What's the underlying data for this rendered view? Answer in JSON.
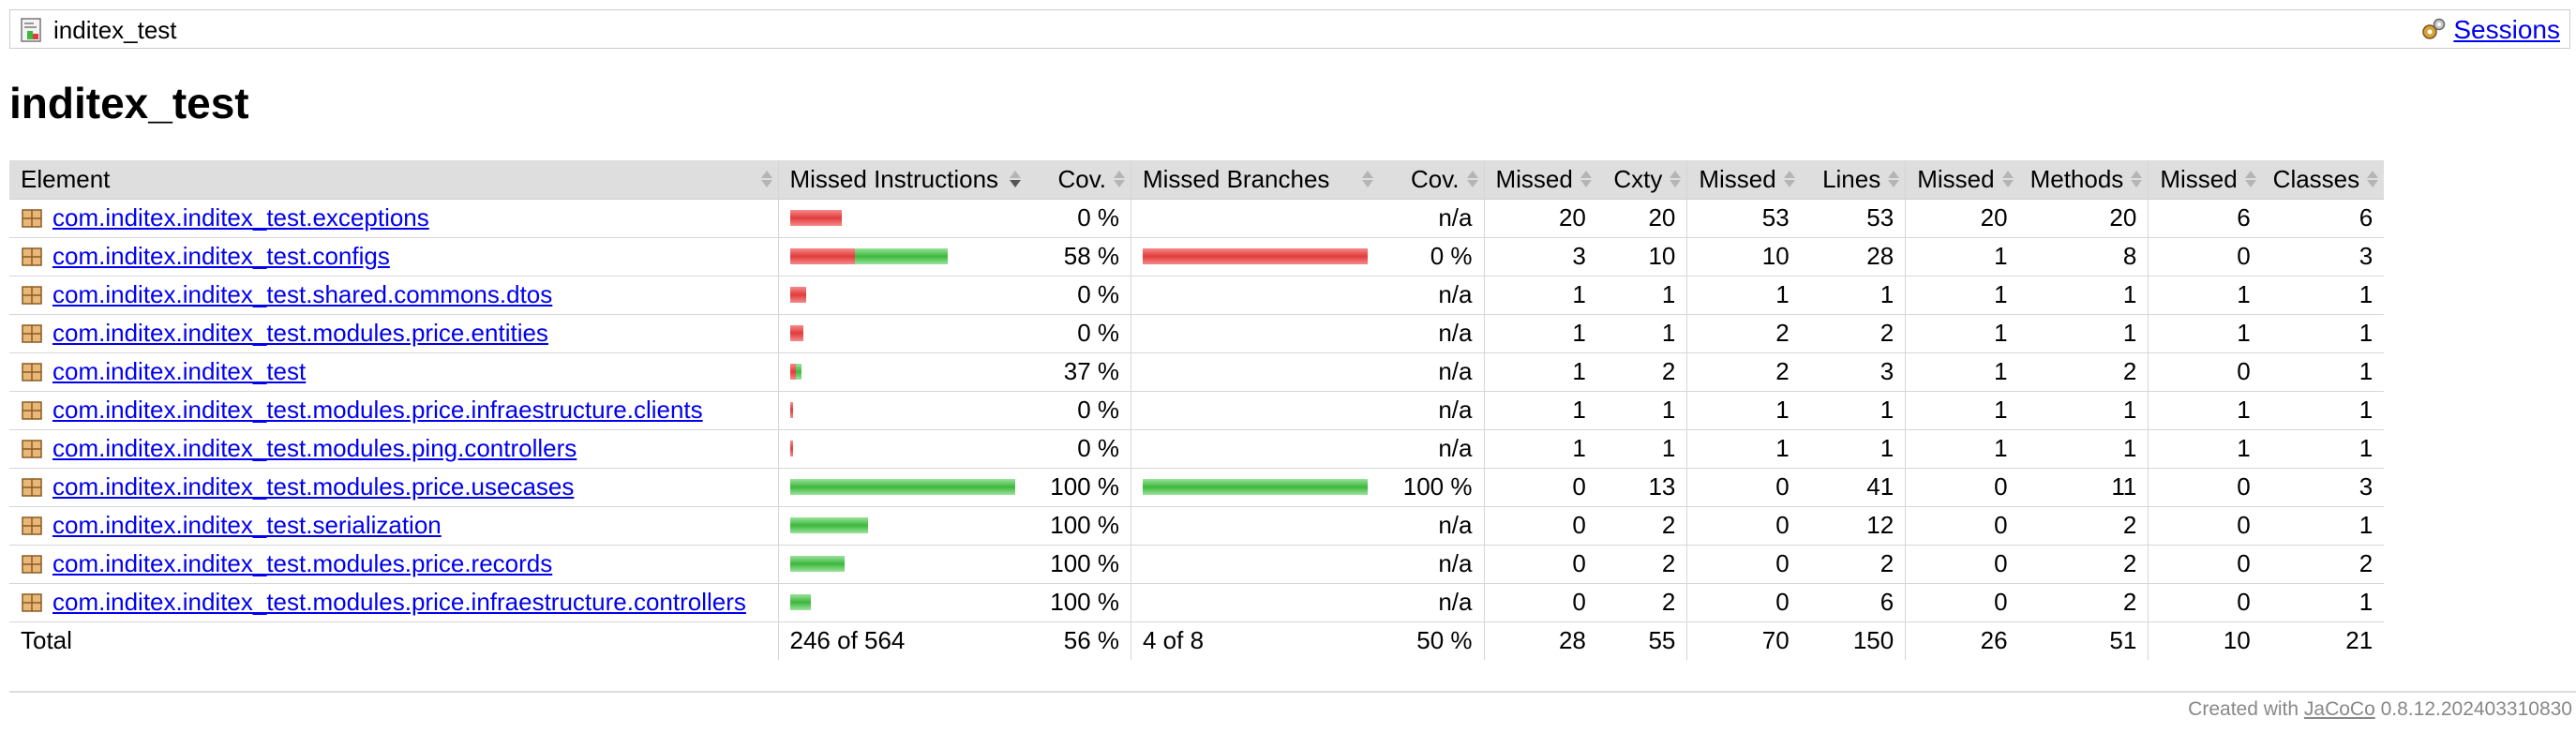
{
  "breadcrumb": {
    "title": "inditex_test",
    "sessions_label": "Sessions"
  },
  "page_title": "inditex_test",
  "table": {
    "headers": {
      "element": "Element",
      "missed_instructions": "Missed Instructions",
      "cov_instructions": "Cov.",
      "missed_branches": "Missed Branches",
      "cov_branches": "Cov.",
      "missed_cxty": "Missed",
      "cxty": "Cxty",
      "missed_lines": "Missed",
      "lines": "Lines",
      "missed_methods": "Missed",
      "methods": "Methods",
      "missed_classes": "Missed",
      "classes": "Classes"
    },
    "rows": [
      {
        "element": "com.inditex.inditex_test.exceptions",
        "instr_missed": 20,
        "instr_total": 20,
        "instr_cov": "0 %",
        "branch_missed": 0,
        "branch_covered": 0,
        "branch_cov": "n/a",
        "missed_cxty": "20",
        "cxty": "20",
        "missed_lines": "53",
        "lines": "53",
        "missed_methods": "20",
        "methods": "20",
        "missed_classes": "6",
        "classes": "6"
      },
      {
        "element": "com.inditex.inditex_test.configs",
        "instr_missed": 25,
        "instr_total": 61,
        "instr_cov": "58 %",
        "branch_missed": 4,
        "branch_covered": 0,
        "branch_cov": "0 %",
        "missed_cxty": "3",
        "cxty": "10",
        "missed_lines": "10",
        "lines": "28",
        "missed_methods": "1",
        "methods": "8",
        "missed_classes": "0",
        "classes": "3"
      },
      {
        "element": "com.inditex.inditex_test.shared.commons.dtos",
        "instr_missed": 6,
        "instr_total": 6,
        "instr_cov": "0 %",
        "branch_missed": 0,
        "branch_covered": 0,
        "branch_cov": "n/a",
        "missed_cxty": "1",
        "cxty": "1",
        "missed_lines": "1",
        "lines": "1",
        "missed_methods": "1",
        "methods": "1",
        "missed_classes": "1",
        "classes": "1"
      },
      {
        "element": "com.inditex.inditex_test.modules.price.entities",
        "instr_missed": 5,
        "instr_total": 5,
        "instr_cov": "0 %",
        "branch_missed": 0,
        "branch_covered": 0,
        "branch_cov": "n/a",
        "missed_cxty": "1",
        "cxty": "1",
        "missed_lines": "2",
        "lines": "2",
        "missed_methods": "1",
        "methods": "1",
        "missed_classes": "1",
        "classes": "1"
      },
      {
        "element": "com.inditex.inditex_test",
        "instr_missed": 2,
        "instr_total": 4,
        "instr_cov": "37 %",
        "branch_missed": 0,
        "branch_covered": 0,
        "branch_cov": "n/a",
        "missed_cxty": "1",
        "cxty": "2",
        "missed_lines": "2",
        "lines": "3",
        "missed_methods": "1",
        "methods": "2",
        "missed_classes": "0",
        "classes": "1"
      },
      {
        "element": "com.inditex.inditex_test.modules.price.infraestructure.clients",
        "instr_missed": 1,
        "instr_total": 1,
        "instr_cov": "0 %",
        "branch_missed": 0,
        "branch_covered": 0,
        "branch_cov": "n/a",
        "missed_cxty": "1",
        "cxty": "1",
        "missed_lines": "1",
        "lines": "1",
        "missed_methods": "1",
        "methods": "1",
        "missed_classes": "1",
        "classes": "1"
      },
      {
        "element": "com.inditex.inditex_test.modules.ping.controllers",
        "instr_missed": 1,
        "instr_total": 1,
        "instr_cov": "0 %",
        "branch_missed": 0,
        "branch_covered": 0,
        "branch_cov": "n/a",
        "missed_cxty": "1",
        "cxty": "1",
        "missed_lines": "1",
        "lines": "1",
        "missed_methods": "1",
        "methods": "1",
        "missed_classes": "1",
        "classes": "1"
      },
      {
        "element": "com.inditex.inditex_test.modules.price.usecases",
        "instr_missed": 0,
        "instr_total": 87,
        "instr_cov": "100 %",
        "branch_missed": 0,
        "branch_covered": 4,
        "branch_cov": "100 %",
        "missed_cxty": "0",
        "cxty": "13",
        "missed_lines": "0",
        "lines": "41",
        "missed_methods": "0",
        "methods": "11",
        "missed_classes": "0",
        "classes": "3"
      },
      {
        "element": "com.inditex.inditex_test.serialization",
        "instr_missed": 0,
        "instr_total": 30,
        "instr_cov": "100 %",
        "branch_missed": 0,
        "branch_covered": 0,
        "branch_cov": "n/a",
        "missed_cxty": "0",
        "cxty": "2",
        "missed_lines": "0",
        "lines": "12",
        "missed_methods": "0",
        "methods": "2",
        "missed_classes": "0",
        "classes": "1"
      },
      {
        "element": "com.inditex.inditex_test.modules.price.records",
        "instr_missed": 0,
        "instr_total": 21,
        "instr_cov": "100 %",
        "branch_missed": 0,
        "branch_covered": 0,
        "branch_cov": "n/a",
        "missed_cxty": "0",
        "cxty": "2",
        "missed_lines": "0",
        "lines": "2",
        "missed_methods": "0",
        "methods": "2",
        "missed_classes": "0",
        "classes": "2"
      },
      {
        "element": "com.inditex.inditex_test.modules.price.infraestructure.controllers",
        "instr_missed": 0,
        "instr_total": 8,
        "instr_cov": "100 %",
        "branch_missed": 0,
        "branch_covered": 0,
        "branch_cov": "n/a",
        "missed_cxty": "0",
        "cxty": "2",
        "missed_lines": "0",
        "lines": "6",
        "missed_methods": "0",
        "methods": "2",
        "missed_classes": "0",
        "classes": "1"
      }
    ],
    "total": {
      "label": "Total",
      "instructions": "246 of 564",
      "instr_cov": "56 %",
      "branches": "4 of 8",
      "branch_cov": "50 %",
      "missed_cxty": "28",
      "cxty": "55",
      "missed_lines": "70",
      "lines": "150",
      "missed_methods": "26",
      "methods": "51",
      "missed_classes": "10",
      "classes": "21"
    }
  },
  "footer": {
    "prefix": "Created with ",
    "link": "JaCoCo",
    "suffix": " 0.8.12.202403310830"
  },
  "colors": {
    "missed_bar": "#e23b3b",
    "covered_bar": "#3cb83c",
    "header_bg": "#dedede",
    "link": "#0000ee"
  }
}
